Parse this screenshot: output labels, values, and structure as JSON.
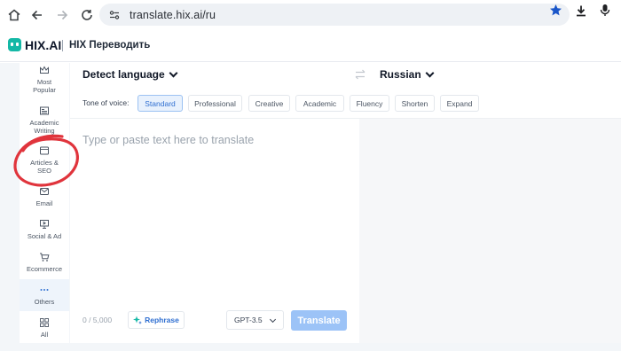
{
  "browser": {
    "url": "translate.hix.ai/ru"
  },
  "app": {
    "logo_text": "HIX.AI",
    "title": "HIX Переводить"
  },
  "sidebar": {
    "items": [
      {
        "label": "Most Popular",
        "icon": "crown-icon"
      },
      {
        "label": "Academic Writing",
        "icon": "newspaper-icon"
      },
      {
        "label": "Articles & SEO",
        "icon": "browser-window-icon"
      },
      {
        "label": "Email",
        "icon": "mail-icon"
      },
      {
        "label": "Social & Ad",
        "icon": "presentation-icon"
      },
      {
        "label": "Ecommerce",
        "icon": "cart-icon"
      },
      {
        "label": "Others",
        "icon": "more-dots-icon",
        "active": true
      },
      {
        "label": "All",
        "icon": "grid-icon"
      }
    ]
  },
  "translator": {
    "source_language": "Detect language",
    "target_language": "Russian",
    "tone_label": "Tone of voice:",
    "tones": [
      "Standard",
      "Professional",
      "Creative",
      "Academic",
      "Fluency",
      "Shorten",
      "Expand"
    ],
    "selected_tone": "Standard",
    "placeholder": "Type or paste text here to translate",
    "char_count": "0 / 5,000",
    "rephrase_label": "Rephrase",
    "model": "GPT-3.5",
    "translate_label": "Translate"
  },
  "colors": {
    "accent": "#2f6fd1",
    "translate_button": "#9cc3f7",
    "annotation": "#e0343c",
    "logo": "#14b8a6"
  }
}
